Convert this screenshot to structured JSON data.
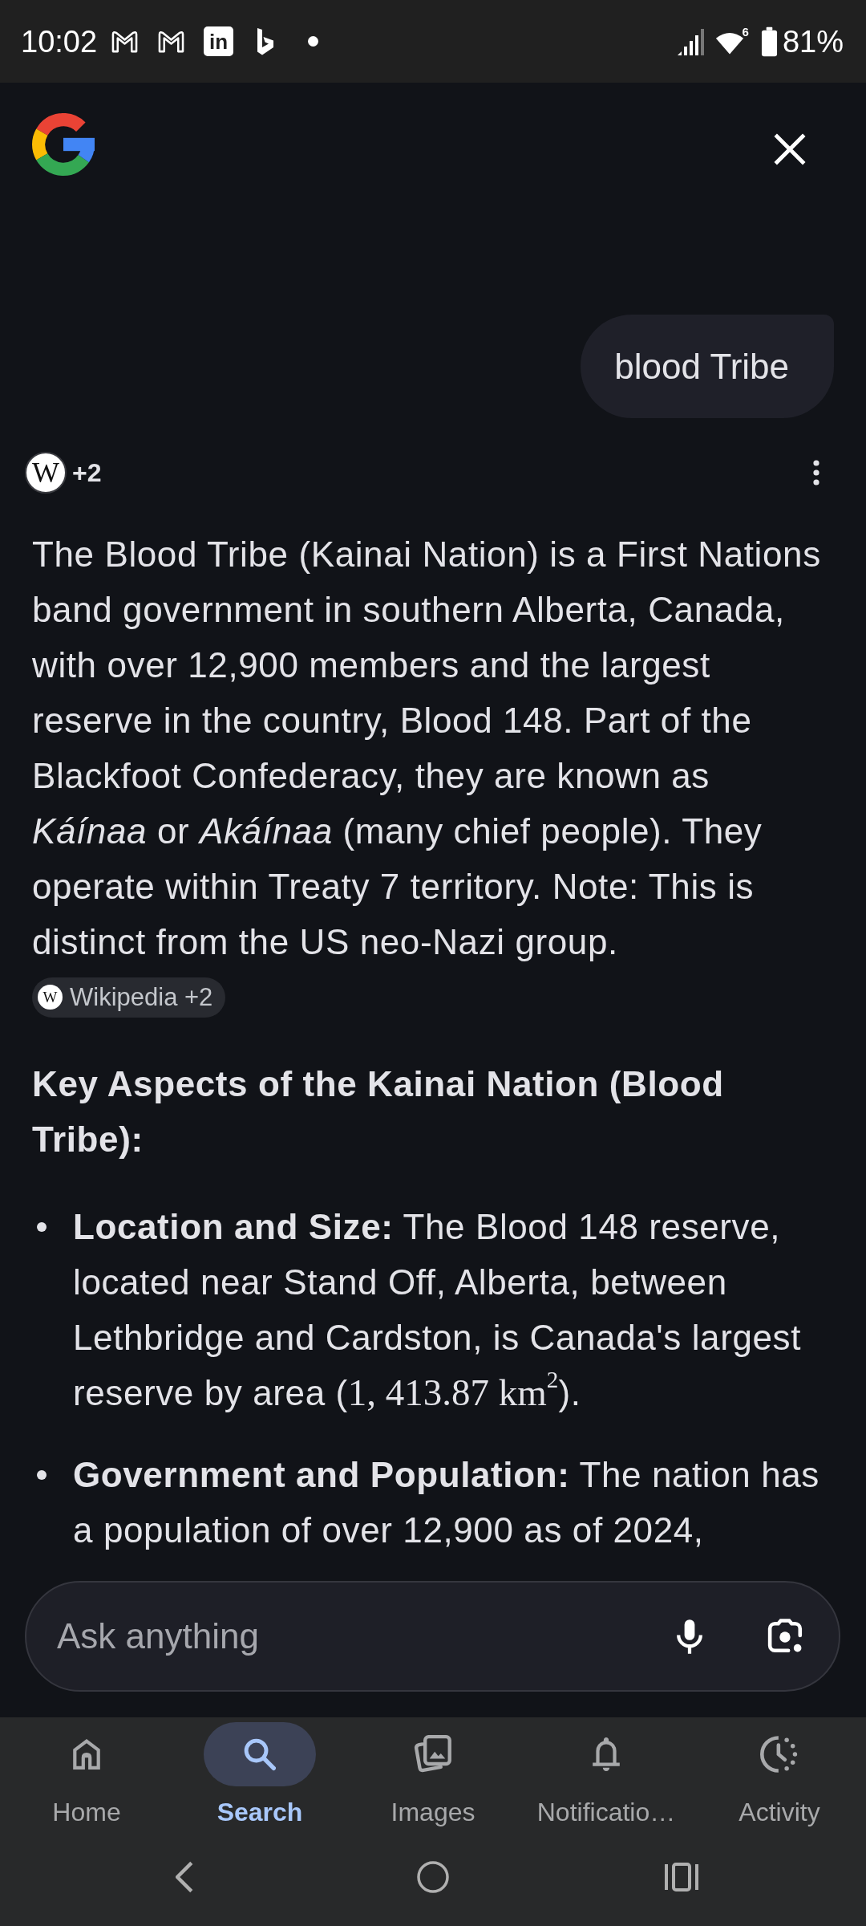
{
  "status_bar": {
    "time": "10:02",
    "app_badge": "in",
    "wifi_badge": "6",
    "battery": "81%"
  },
  "query": "blood Tribe",
  "sources": {
    "logo_letter": "W",
    "count": "+2"
  },
  "answer": {
    "paragraph": "The Blood Tribe (Kainai Nation) is a First Nations band government in southern Alberta, Canada, with over 12,900 members and the largest reserve in the country, Blood 148. Part of the Blackfoot Confederacy, they are known as *Káínaa* or *Akáínaa* (many chief people). They operate within Treaty 7 territory. Note: This is distinct from the US neo-Nazi group.",
    "citation": {
      "logo_letter": "W",
      "label": "Wikipedia +2"
    },
    "heading": "Key Aspects of the Kainai Nation (Blood Tribe):",
    "bullets": [
      {
        "text": "**Location and Size:** The Blood 148 reserve, located near Stand Off, Alberta, between Lethbridge and Cardston, is Canada's largest reserve by area (",
        "math": "1, 413.87 km$^{2}$",
        "after": ")."
      },
      {
        "text": "**Government and Population:** The nation has a population of over 12,900 as of 2024,"
      }
    ]
  },
  "ask_bar": {
    "placeholder": "Ask anything"
  },
  "bottom_nav": [
    {
      "label": "Home",
      "selected": false
    },
    {
      "label": "Search",
      "selected": true
    },
    {
      "label": "Images",
      "selected": false
    },
    {
      "label": "Notificatio…",
      "selected": false
    },
    {
      "label": "Activity",
      "selected": false
    }
  ]
}
